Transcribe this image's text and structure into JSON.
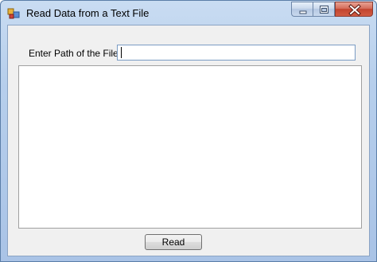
{
  "window": {
    "title": "Read Data from a Text File",
    "icon": "form-app-icon",
    "controls": [
      "minimize-icon",
      "maximize-icon",
      "close-icon"
    ]
  },
  "form": {
    "path_label": "Enter Path of the File:",
    "path_value": "",
    "content_value": "",
    "read_button_label": "Read"
  },
  "colors": {
    "titlebar": "#b7cfec",
    "client_background": "#f0f0f0",
    "close_button": "#c2432e"
  }
}
